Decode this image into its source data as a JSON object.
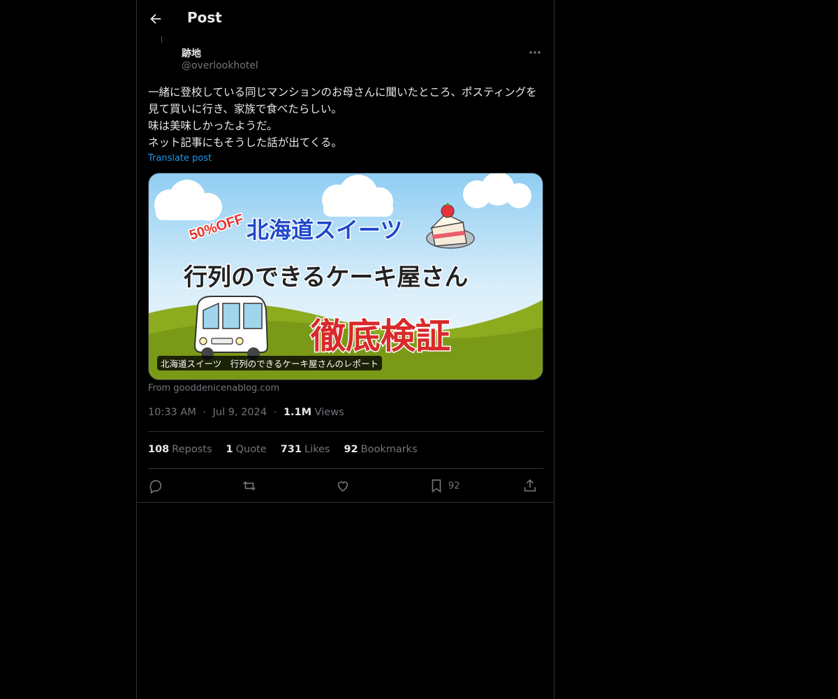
{
  "header": {
    "title": "Post"
  },
  "author": {
    "name": "跡地",
    "handle": "@overlookhotel"
  },
  "tweet": {
    "text": "一緒に登校している同じマンションのお母さんに聞いたところ、ポスティングを見て買いに行き、家族で食べたらしい。\n味は美味しかったようだ。\nネット記事にもそうした話が出てくる。",
    "translate_label": "Translate post"
  },
  "card": {
    "badge": "50%OFF",
    "headline": "北海道スイーツ",
    "subhead": "行列のできるケーキ屋さん",
    "banner": "徹底検証",
    "caption": "北海道スイーツ　行列のできるケーキ屋さんのレポート",
    "source": "From gooddenicenablog.com"
  },
  "meta": {
    "time": "10:33 AM",
    "date": "Jul 9, 2024",
    "views_count": "1.1M",
    "views_label": "Views",
    "separator": "·"
  },
  "stats": [
    {
      "count": "108",
      "label": "Reposts"
    },
    {
      "count": "1",
      "label": "Quote"
    },
    {
      "count": "731",
      "label": "Likes"
    },
    {
      "count": "92",
      "label": "Bookmarks"
    }
  ],
  "actions": {
    "bookmark_count": "92"
  },
  "colors": {
    "background": "#000000",
    "accent": "#1d9bf0",
    "muted": "#71767b",
    "text": "#e7e9ea",
    "border": "#2f3336"
  }
}
